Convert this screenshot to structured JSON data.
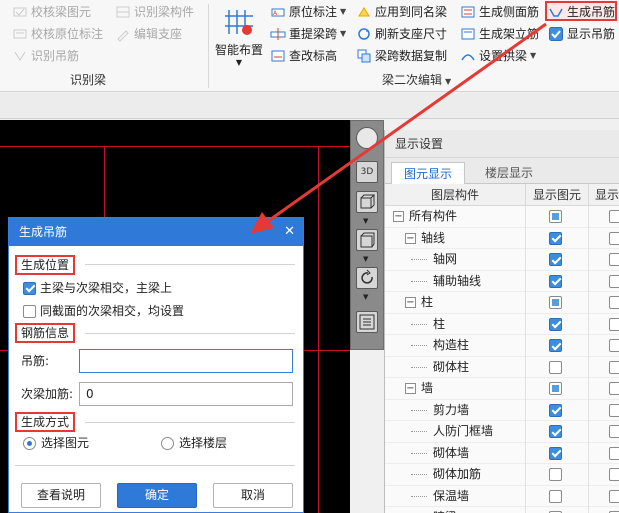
{
  "ribbon": {
    "identify_group": {
      "items": [
        "校核梁图元",
        "识别梁构件",
        "校核原位标注",
        "编辑支座",
        "识别吊筋"
      ],
      "label": "识别梁"
    },
    "edit_group": {
      "smart_layout": "智能布置",
      "col1": [
        "原位标注",
        "重提梁跨",
        "查改标高"
      ],
      "col2": [
        "应用到同名梁",
        "刷新支座尺寸",
        "梁跨数据复制"
      ],
      "col3": [
        "生成侧面筋",
        "生成架立筋",
        "设置拱梁"
      ],
      "col4": [
        "生成吊筋",
        "显示吊筋"
      ],
      "label": "梁二次编辑"
    }
  },
  "vtool": {
    "btn_3d": "3D"
  },
  "panel": {
    "title": "显示设置",
    "tabs": [
      "图元显示",
      "楼层显示"
    ],
    "headers": [
      "图层构件",
      "显示图元",
      "显示名"
    ],
    "rows": [
      {
        "label": "所有构件",
        "level": 0,
        "toggle": "−",
        "show": "part",
        "name": "off"
      },
      {
        "label": "轴线",
        "level": 1,
        "toggle": "−",
        "show": "on",
        "name": "off"
      },
      {
        "label": "轴网",
        "level": 2,
        "show": "on",
        "name": "off"
      },
      {
        "label": "辅助轴线",
        "level": 2,
        "show": "on",
        "name": "off"
      },
      {
        "label": "柱",
        "level": 1,
        "toggle": "−",
        "show": "part",
        "name": "off"
      },
      {
        "label": "柱",
        "level": 2,
        "show": "on",
        "name": "off"
      },
      {
        "label": "构造柱",
        "level": 2,
        "show": "on",
        "name": "off"
      },
      {
        "label": "砌体柱",
        "level": 2,
        "show": "off",
        "name": "off"
      },
      {
        "label": "墙",
        "level": 1,
        "toggle": "−",
        "show": "part",
        "name": "off"
      },
      {
        "label": "剪力墙",
        "level": 2,
        "show": "on",
        "name": "off"
      },
      {
        "label": "人防门框墙",
        "level": 2,
        "show": "on",
        "name": "off"
      },
      {
        "label": "砌体墙",
        "level": 2,
        "show": "on",
        "name": "off"
      },
      {
        "label": "砌体加筋",
        "level": 2,
        "show": "off",
        "name": "off"
      },
      {
        "label": "保温墙",
        "level": 2,
        "show": "off",
        "name": "off"
      },
      {
        "label": "暗梁",
        "level": 2,
        "show": "off",
        "name": "off"
      }
    ]
  },
  "dialog": {
    "title": "生成吊筋",
    "section_position": "生成位置",
    "opt1": "主梁与次梁相交，主梁上",
    "opt2": "同截面的次梁相交，均设置",
    "section_rebar": "钢筋信息",
    "hanger_label": "吊筋:",
    "hanger_value": "",
    "secondary_label": "次梁加筋:",
    "secondary_value": "0",
    "section_method": "生成方式",
    "radio_select": "选择图元",
    "radio_floor": "选择楼层",
    "btn_help": "查看说明",
    "btn_ok": "确定",
    "btn_cancel": "取消"
  },
  "colors": {
    "accent": "#2f7ad8",
    "highlight": "#e53935",
    "canvas_line": "#c8102e"
  }
}
